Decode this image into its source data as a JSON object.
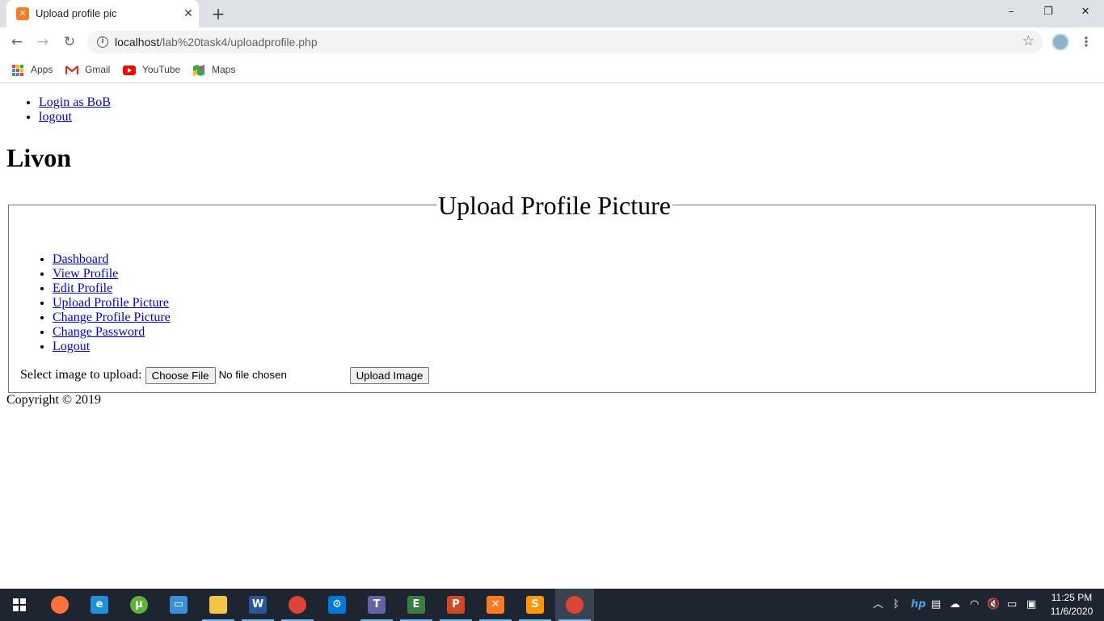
{
  "browser": {
    "tab_title": "Upload profile pic",
    "tab_favicon": "xampp-icon",
    "url_host": "localhost",
    "url_path": "/lab%20task4/uploadprofile.php",
    "window_controls": {
      "minimize": "–",
      "restore": "❐",
      "close": "✕"
    },
    "bookmarks": [
      {
        "label": "Apps",
        "icon": "apps-grid-icon"
      },
      {
        "label": "Gmail",
        "icon": "gmail-icon",
        "color": "#d93025"
      },
      {
        "label": "YouTube",
        "icon": "youtube-icon",
        "color": "#ff0000"
      },
      {
        "label": "Maps",
        "icon": "maps-icon",
        "color": "#34a853"
      }
    ]
  },
  "page": {
    "top_nav": [
      "Login as BoB",
      "logout"
    ],
    "site_title": "Livon",
    "legend": "Upload Profile Picture",
    "side_nav": [
      "Dashboard",
      "View Profile",
      "Edit Profile",
      "Upload Profile Picture",
      "Change Profile Picture",
      "Change Password",
      "Logout"
    ],
    "upload": {
      "label": "Select image to upload:",
      "choose_button": "Choose File",
      "no_file_text": "No file chosen",
      "submit_button": "Upload Image"
    },
    "footer": "Copyright © 2019"
  },
  "taskbar": {
    "apps": [
      {
        "name": "firefox-icon",
        "color": "#ff7139",
        "active": false
      },
      {
        "name": "edge-icon",
        "color": "#1e90e0",
        "active": false
      },
      {
        "name": "utorrent-icon",
        "color": "#5fb336",
        "active": false
      },
      {
        "name": "remote-desktop-icon",
        "color": "#3a8fd8",
        "active": false
      },
      {
        "name": "file-explorer-icon",
        "color": "#f4c542",
        "active": true
      },
      {
        "name": "word-icon",
        "color": "#2b579a",
        "active": true
      },
      {
        "name": "chrome-icon",
        "color": "#db4437",
        "active": true
      },
      {
        "name": "settings-icon",
        "color": "#0078d7",
        "active": false
      },
      {
        "name": "teams-icon",
        "color": "#6264a7",
        "active": true
      },
      {
        "name": "app-e-icon",
        "color": "#3a7d44",
        "active": true
      },
      {
        "name": "powerpoint-icon",
        "color": "#d24726",
        "active": true
      },
      {
        "name": "xampp-icon",
        "color": "#fb7a24",
        "active": true
      },
      {
        "name": "sublime-text-icon",
        "color": "#ff9800",
        "active": true
      },
      {
        "name": "chrome-profile-icon",
        "color": "#db4437",
        "active": true
      }
    ],
    "clock_time": "11:25 PM",
    "clock_date": "11/6/2020"
  }
}
